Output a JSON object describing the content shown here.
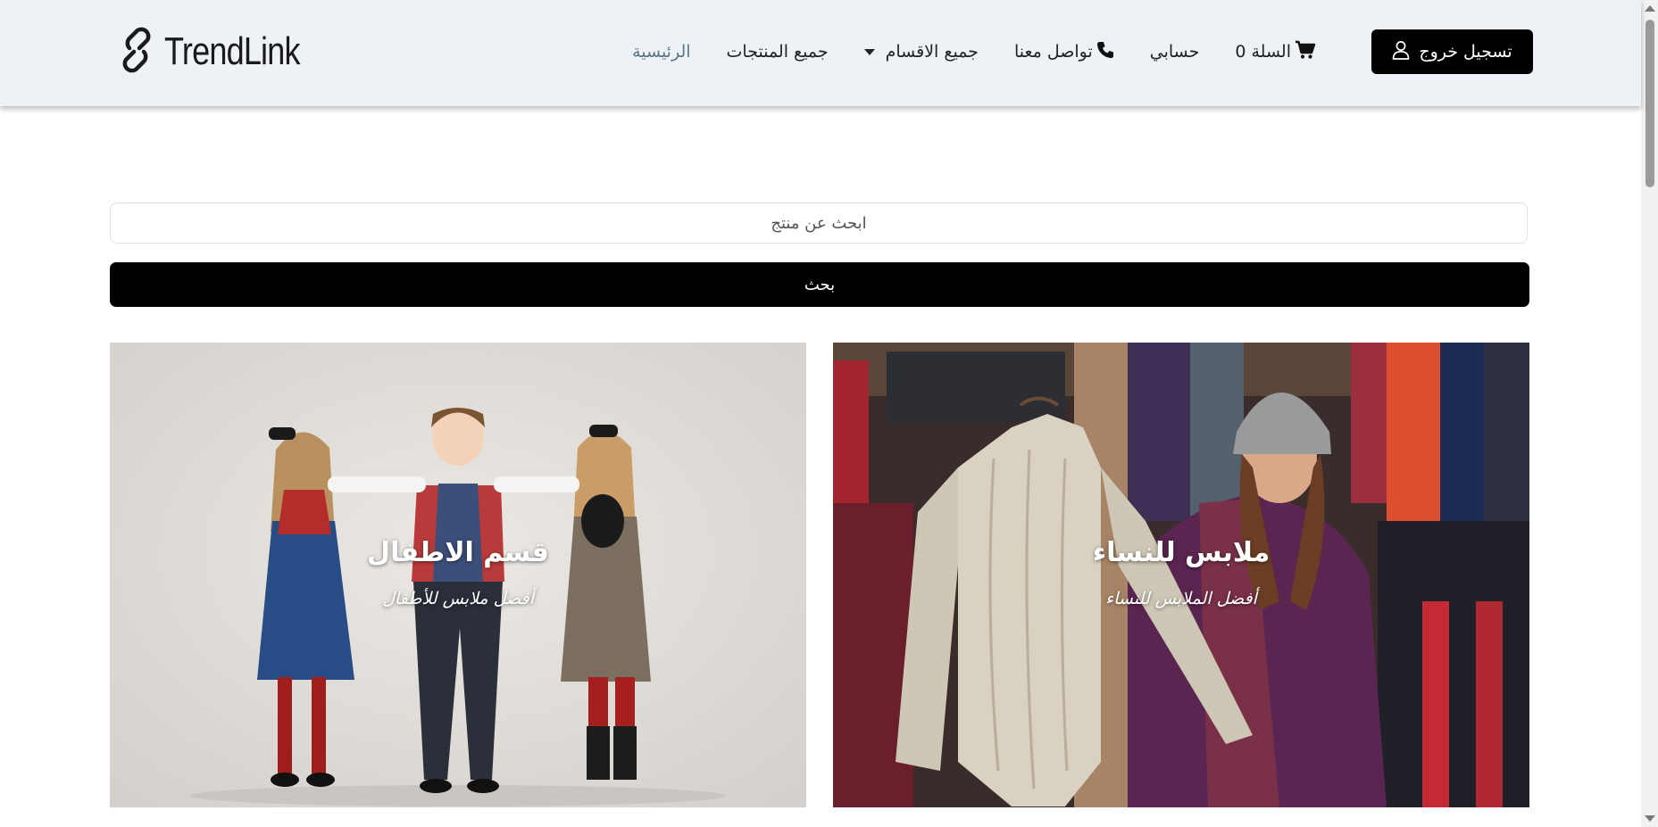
{
  "navbar": {
    "brand": "TrendLink",
    "links": {
      "home": "الرئيسية",
      "all_products": "جميع المنتجات",
      "all_categories": "جميع الاقسام",
      "contact": "تواصل معنا",
      "account": "حسابي",
      "cart": "السلة 0"
    },
    "logout_label": "تسجيل خروج"
  },
  "search": {
    "placeholder": "ابحث عن منتج",
    "button_label": "بحث"
  },
  "categories": [
    {
      "title": "قسم الاطفال",
      "subtitle": "أفضل ملابس للأطفال"
    },
    {
      "title": "ملابس للنساء",
      "subtitle": "أفضل الملابس للنساء"
    }
  ],
  "colors": {
    "navbar_bg": "#eef2f7",
    "button_bg": "#000000",
    "active_link": "#5c7784"
  },
  "icons": [
    "link-logo-icon",
    "phone-icon",
    "cart-icon",
    "user-icon",
    "chevron-down-icon"
  ]
}
